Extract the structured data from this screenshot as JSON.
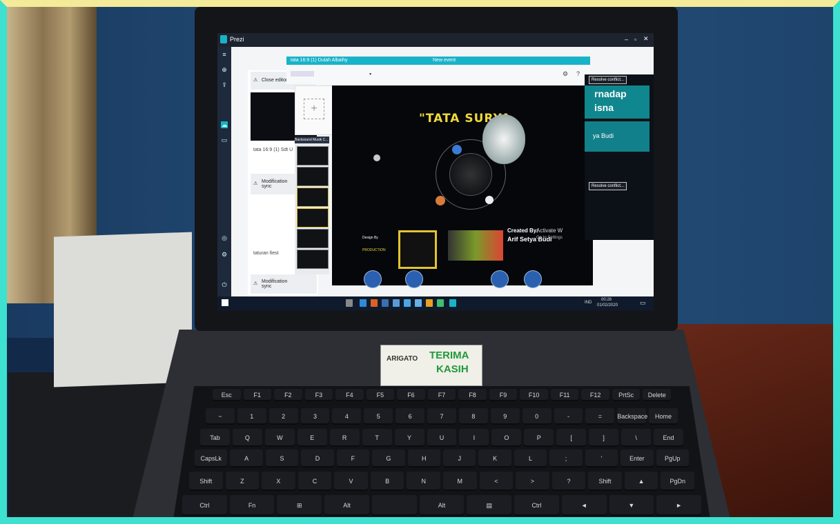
{
  "window": {
    "app_title": "Prezi",
    "doc_title": "tata 16:9 (1) Dulah Albaihy",
    "new_event": "New event"
  },
  "panels": {
    "close_editor": "Close editor",
    "file_label": "tata 16:9 (1) Sdt U",
    "mod_warning_1": "Modification sync",
    "mod_warning_2": "Modification sync",
    "file_label_2": "taturan fiest",
    "thumb_header": "Backsound Musik C..."
  },
  "slide": {
    "title": "\"TATA SURYA",
    "credit_heading": "Created By:",
    "credit_name": "Arif Setya Budi",
    "design_by": "Design By",
    "production": "PRODUCTION"
  },
  "right_panel": {
    "resolve_1": "Resolve conflict...",
    "resolve_2": "Resolve conflict...",
    "banner_1": "rnadap",
    "banner_1b": "isna",
    "banner_2": "ya Budi",
    "activate_title": "Activate W",
    "activate_sub": "Go to Settings"
  },
  "taskbar": {
    "lang": "IND",
    "time": "00:28",
    "date": "01/02/2020"
  },
  "sticker": {
    "line1": "TERIMA",
    "line2": "KASIH",
    "word": "ARIGATO"
  },
  "keyboard": {
    "row1": [
      "Esc",
      "F1",
      "F2",
      "F3",
      "F4",
      "F5",
      "F6",
      "F7",
      "F8",
      "F9",
      "F10",
      "F11",
      "F12",
      "PrtSc",
      "Delete"
    ],
    "row2": [
      "~",
      "1",
      "2",
      "3",
      "4",
      "5",
      "6",
      "7",
      "8",
      "9",
      "0",
      "-",
      "=",
      "Backspace",
      "Home"
    ],
    "row3": [
      "Tab",
      "Q",
      "W",
      "E",
      "R",
      "T",
      "Y",
      "U",
      "I",
      "O",
      "P",
      "[",
      "]",
      "\\",
      "End"
    ],
    "row4": [
      "CapsLk",
      "A",
      "S",
      "D",
      "F",
      "G",
      "H",
      "J",
      "K",
      "L",
      ";",
      "'",
      "Enter",
      "PgUp"
    ],
    "row5": [
      "Shift",
      "Z",
      "X",
      "C",
      "V",
      "B",
      "N",
      "M",
      "<",
      ">",
      "?",
      "Shift",
      "▲",
      "PgDn"
    ],
    "row6": [
      "Ctrl",
      "Fn",
      "⊞",
      "Alt",
      "",
      "Alt",
      "▤",
      "Ctrl",
      "◄",
      "▼",
      "►"
    ]
  },
  "colors": {
    "frame_top": "#f3eb9a",
    "frame_side": "#3ee0d0",
    "prezi_blue": "#19b3c9",
    "title_yellow": "#f0d93a"
  }
}
